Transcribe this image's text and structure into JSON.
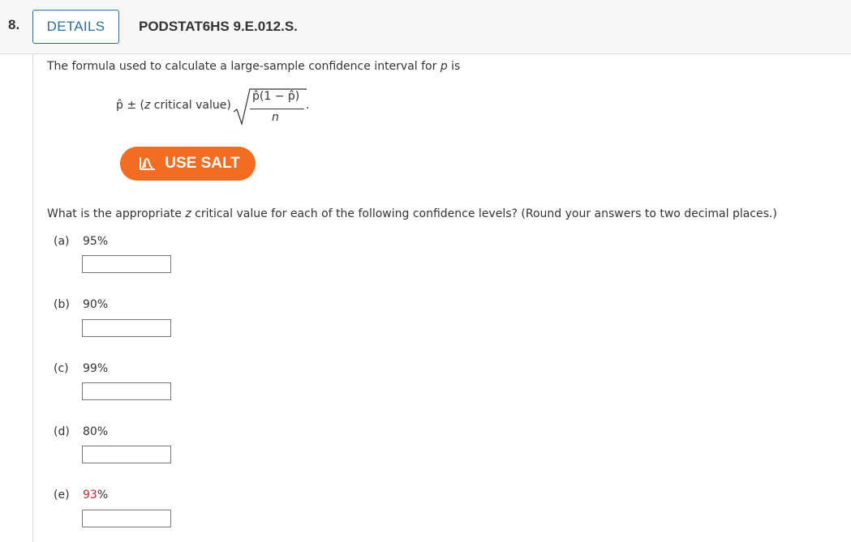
{
  "header": {
    "question_number": "8.",
    "details_label": "DETAILS",
    "problem_id": "PODSTAT6HS 9.E.012.S."
  },
  "intro": {
    "text_before": "The formula used to calculate a large-sample confidence interval for ",
    "variable": "p",
    "text_after": " is"
  },
  "formula": {
    "p_hat": "p̂",
    "plus_minus": "±",
    "open_paren": "(",
    "z": "z",
    "critical_value": " critical value)",
    "numerator": "p̂(1 − p̂)",
    "denominator": "n",
    "period": "."
  },
  "salt_button": {
    "label": "USE SALT",
    "icon": "salt-distribution-icon"
  },
  "question": {
    "text_before": "What is the appropriate ",
    "variable": "z",
    "text_after": " critical value for each of the following confidence levels? (Round your answers to two decimal places.)"
  },
  "parts": [
    {
      "letter": "(a)",
      "value": "95",
      "unit": "%",
      "answer": ""
    },
    {
      "letter": "(b)",
      "value": "90",
      "unit": "%",
      "answer": ""
    },
    {
      "letter": "(c)",
      "value": "99",
      "unit": "%",
      "answer": ""
    },
    {
      "letter": "(d)",
      "value": "80",
      "unit": "%",
      "answer": ""
    },
    {
      "letter": "(e)",
      "value": "93",
      "unit": "%",
      "answer": ""
    }
  ],
  "colors": {
    "details_border": "#2a6d9e",
    "salt_button": "#f26c21",
    "highlight_red": "#c1272d"
  }
}
